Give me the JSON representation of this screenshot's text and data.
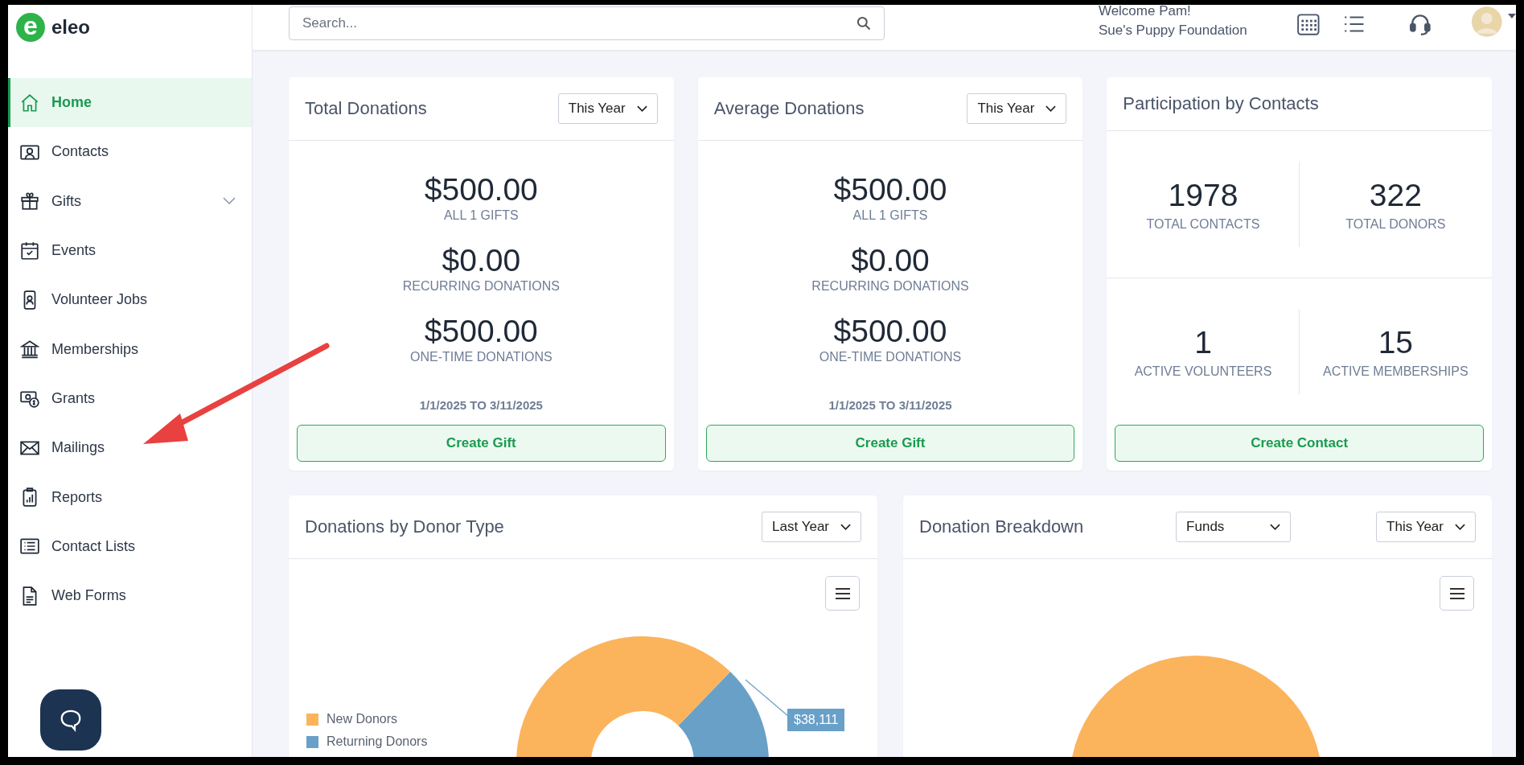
{
  "app": {
    "logo_letter": "e",
    "name": "eleo"
  },
  "sidebar": {
    "items": [
      {
        "label": "Home",
        "selected": true
      },
      {
        "label": "Contacts",
        "selected": false
      },
      {
        "label": "Gifts",
        "selected": false,
        "expanded": false
      },
      {
        "label": "Events",
        "selected": false
      },
      {
        "label": "Volunteer Jobs",
        "selected": false
      },
      {
        "label": "Memberships",
        "selected": false
      },
      {
        "label": "Grants",
        "selected": false
      },
      {
        "label": "Mailings",
        "selected": false
      },
      {
        "label": "Reports",
        "selected": false
      },
      {
        "label": "Contact Lists",
        "selected": false
      },
      {
        "label": "Web Forms",
        "selected": false
      }
    ]
  },
  "header": {
    "search": {
      "placeholder": "Search..."
    },
    "welcome": "Welcome Pam!",
    "organization": "Sue's Puppy Foundation"
  },
  "cards": [
    {
      "kind": "stack",
      "title": "Total Donations",
      "period": "This Year",
      "stats": [
        {
          "value": "$500.00",
          "label": "ALL 1 GIFTS"
        },
        {
          "value": "$0.00",
          "label": "RECURRING DONATIONS"
        },
        {
          "value": "$500.00",
          "label": "ONE-TIME DONATIONS"
        }
      ],
      "date_range": "1/1/2025 TO 3/11/2025",
      "button": "Create Gift"
    },
    {
      "kind": "stack",
      "title": "Average Donations",
      "period": "This Year",
      "stats": [
        {
          "value": "$500.00",
          "label": "ALL 1 GIFTS"
        },
        {
          "value": "$0.00",
          "label": "RECURRING DONATIONS"
        },
        {
          "value": "$500.00",
          "label": "ONE-TIME DONATIONS"
        }
      ],
      "date_range": "1/1/2025 TO 3/11/2025",
      "button": "Create Gift"
    },
    {
      "kind": "grid",
      "title": "Participation by Contacts",
      "stats": [
        {
          "value": "1978",
          "label": "TOTAL CONTACTS"
        },
        {
          "value": "322",
          "label": "TOTAL DONORS"
        },
        {
          "value": "1",
          "label": "ACTIVE VOLUNTEERS"
        },
        {
          "value": "15",
          "label": "ACTIVE MEMBERSHIPS"
        }
      ],
      "button": "Create Contact"
    }
  ],
  "charts": [
    {
      "kind": "donut",
      "title": "Donations by Donor Type",
      "filters": [
        "Last Year"
      ],
      "legend": [
        {
          "label": "New Donors",
          "color": "#fbb45c"
        },
        {
          "label": "Returning Donors",
          "color": "#68a0c8"
        }
      ],
      "data_label": "$38,111"
    },
    {
      "kind": "pie",
      "title": "Donation Breakdown",
      "filters": [
        "Funds",
        "This Year"
      ],
      "color": "#fbb45c"
    }
  ]
}
